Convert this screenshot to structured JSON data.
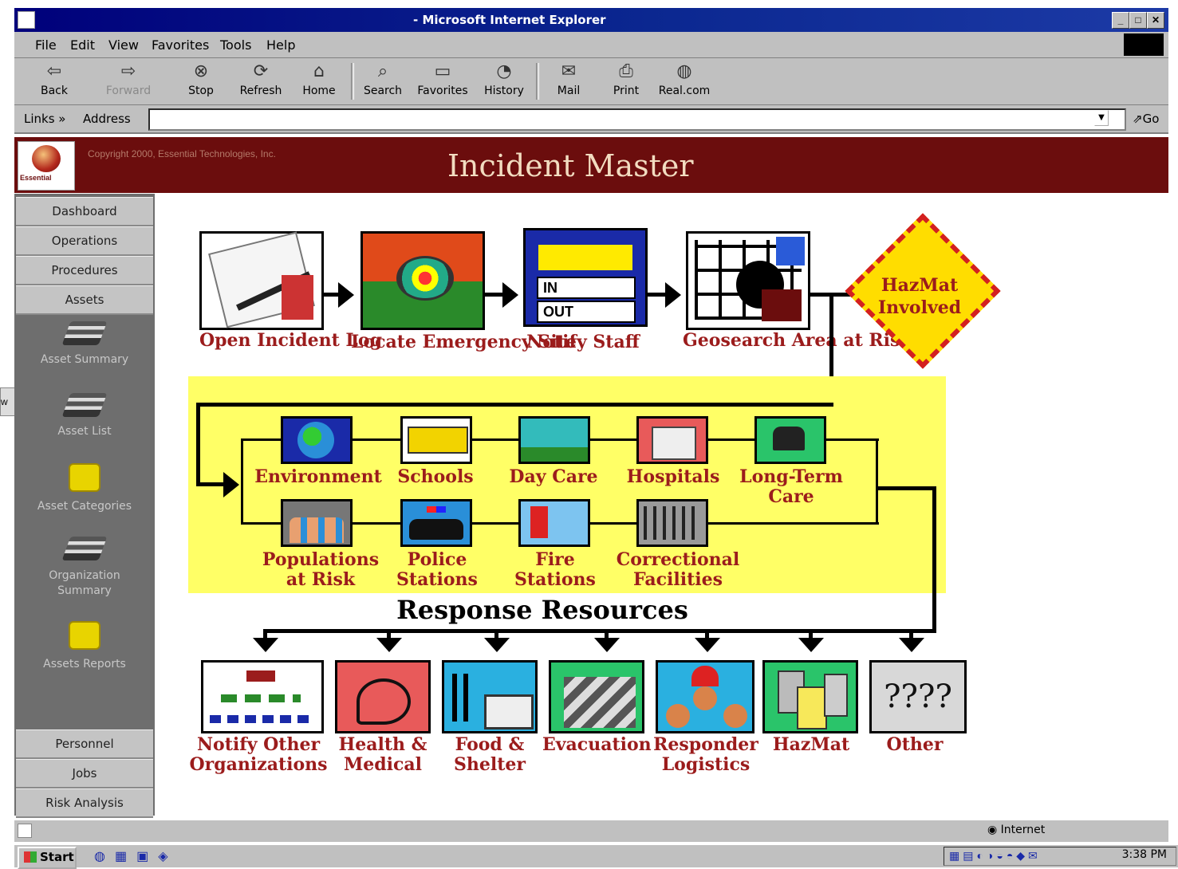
{
  "window": {
    "title": "- Microsoft Internet Explorer",
    "minimize": "_",
    "maximize": "□",
    "close": "✕"
  },
  "menubar": [
    "File",
    "Edit",
    "View",
    "Favorites",
    "Tools",
    "Help"
  ],
  "toolbar": {
    "back": "Back",
    "forward": "Forward",
    "stop": "Stop",
    "refresh": "Refresh",
    "home": "Home",
    "search": "Search",
    "favorites": "Favorites",
    "history": "History",
    "mail": "Mail",
    "print": "Print",
    "real": "Real.com"
  },
  "addressbar": {
    "links": "Links »",
    "address": "Address",
    "value": "",
    "go": "Go"
  },
  "banner": {
    "copyright": "Copyright 2000, Essential Technologies, Inc.",
    "title": "Incident Master",
    "logo_text": "Essential"
  },
  "sidebar": {
    "top": [
      "Dashboard",
      "Operations",
      "Procedures",
      "Assets"
    ],
    "assets": [
      "Asset Summary",
      "Asset List",
      "Asset Categories",
      "Organization Summary",
      "Assets Reports"
    ],
    "bottom": [
      "Personnel",
      "Jobs",
      "Risk Analysis"
    ]
  },
  "flow": {
    "steps": [
      "Open Incident Log",
      "Locate Emergency Site",
      "Notify Staff",
      "Geosearch Area at Risk"
    ],
    "hazmat": "HazMat Involved",
    "notify_in": "IN",
    "notify_out": "OUT",
    "risk_row1": [
      "Environment",
      "Schools",
      "Day Care",
      "Hospitals",
      "Long-Term Care"
    ],
    "risk_row2": [
      "Populations at Risk",
      "Police Stations",
      "Fire Stations",
      "Correctional Facilities"
    ],
    "resources_title": "Response Resources",
    "resources": [
      "Notify Other Organizations",
      "Health & Medical",
      "Food & Shelter",
      "Evacuation",
      "Responder Logistics",
      "HazMat",
      "Other"
    ],
    "other_icon_text": "????"
  },
  "statusbar": {
    "zone": "Internet"
  },
  "taskbar": {
    "start": "Start",
    "clock": "3:38 PM"
  },
  "colors": {
    "banner": "#6b0d0d",
    "label": "#9b1c1c",
    "yellow_panel": "#ffff66",
    "sidebar": "#6e6e6e"
  }
}
